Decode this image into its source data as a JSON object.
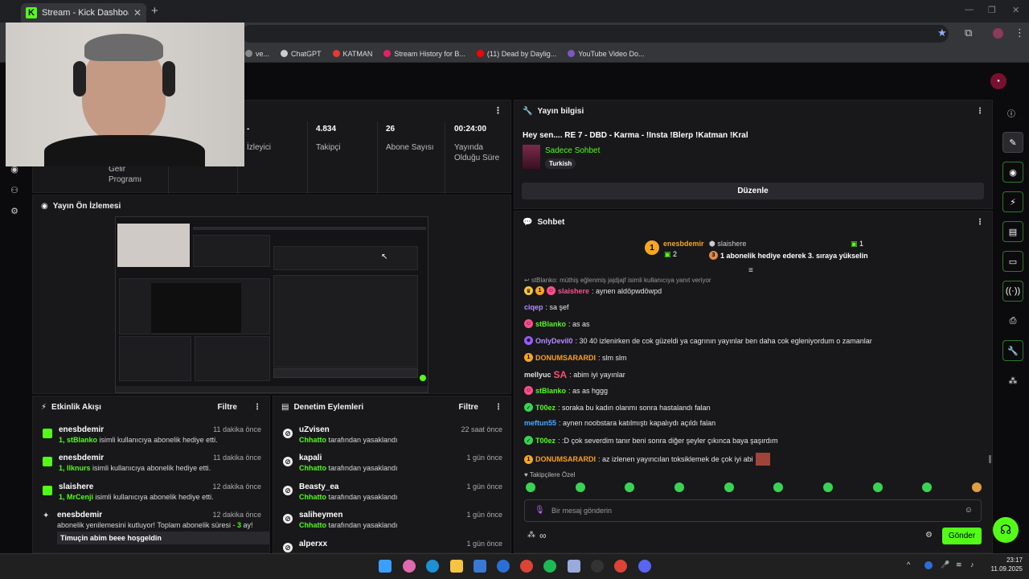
{
  "browser": {
    "tab_title": "Stream - Kick Dashboard",
    "tab_favicon": "K",
    "bookmarks": [
      {
        "label": "ve...",
        "color": "#888888"
      },
      {
        "label": "ChatGPT",
        "color": "#cccccc"
      },
      {
        "label": "KATMAN",
        "color": "#e53935"
      },
      {
        "label": "Stream History for B...",
        "color": "#e91e63"
      },
      {
        "label": "(11) Dead by Daylig...",
        "color": "#ff0000"
      },
      {
        "label": "YouTube Video Do...",
        "color": "#7e57c2"
      }
    ]
  },
  "stats": {
    "items": [
      {
        "num": "-",
        "label": "İzleyici"
      },
      {
        "num": "4.834",
        "label": "Takipçi"
      },
      {
        "num": "26",
        "label": "Abone Sayısı"
      },
      {
        "num": "00:24:00",
        "label": "Yayında Olduğu Süre"
      }
    ],
    "partial_label": "Gelir Programı"
  },
  "preview": {
    "title": "Yayın Ön İzlemesi"
  },
  "activity": {
    "title": "Etkinlik Akışı",
    "filter": "Filtre",
    "items": [
      {
        "name": "enesbdemir",
        "time": "11 dakika önce",
        "count": "1,",
        "target": "stBlanko",
        "text": " isimli kullanıcıya abonelik hediye etti."
      },
      {
        "name": "enesbdemir",
        "time": "11 dakika önce",
        "count": "1,",
        "target": "llknurs",
        "text": " isimli kullanıcıya abonelik hediye etti."
      },
      {
        "name": "slaishere",
        "time": "12 dakika önce",
        "count": "1,",
        "target": "MrCenji",
        "text": " isimli kullanıcıya abonelik hediye etti."
      }
    ],
    "renew": {
      "name": "enesbdemir",
      "time": "12 dakika önce",
      "text_pre": "abonelik yenilemesini kutluyor! Toplam abonelik süresi - ",
      "months": "3",
      "text_post": " ay!",
      "message": "Timuçin abim beee hoşgeldin"
    }
  },
  "moderation": {
    "title": "Denetim Eylemleri",
    "filter": "Filtre",
    "items": [
      {
        "name": "uZvisen",
        "time": "22 saat önce",
        "by": "Chhatto",
        "text": " tarafından yasaklandı"
      },
      {
        "name": "kapali",
        "time": "1 gün önce",
        "by": "Chhatto",
        "text": " tarafından yasaklandı"
      },
      {
        "name": "Beasty_ea",
        "time": "1 gün önce",
        "by": "Chhatto",
        "text": " tarafından yasaklandı"
      },
      {
        "name": "saliheymen",
        "time": "1 gün önce",
        "by": "Chhatto",
        "text": " tarafından yasaklandı"
      },
      {
        "name": "alperxx",
        "time": "1 gün önce",
        "by": "",
        "text": ""
      }
    ]
  },
  "info": {
    "title": "Yayın bilgisi",
    "stream_title": "Hey sen.... RE 7 - DBD - Karma - !Insta !Blerp !Katman !Kral",
    "category": "Sadece Sohbet",
    "language": "Turkish",
    "edit": "Düzenle"
  },
  "chat": {
    "title": "Sohbet",
    "pinned": {
      "rank": "1",
      "gifter": "enesbdemir",
      "gifter_count": "2",
      "user": "slaishere",
      "user_count": "1",
      "rank2": "3",
      "text": "1 abonelik hediye ederek 3. sıraya yükselin"
    },
    "reply_context": "stBlanko: müthiş eğlenmiş jajdjajf isimli kullanıcıya yanıt veriyor",
    "messages": [
      {
        "user": "slaishere",
        "color": "#ff4f8b",
        "text": ": aynen aldöpwdöwpd",
        "badges": [
          "crown",
          "1",
          "mask"
        ]
      },
      {
        "user": "ciqep",
        "color": "#b58cff",
        "text": ": sa şef",
        "badges": []
      },
      {
        "user": "stBlanko",
        "color": "#53fc18",
        "text": ": as as",
        "badges": [
          "mask"
        ]
      },
      {
        "user": "OnlyDevil0",
        "color": "#b58cff",
        "text": ": 30 40 izlenirken de cok güzeldi ya cagrının yayınlar ben daha cok egleniyordum o zamanlar",
        "badges": [
          "devil"
        ]
      },
      {
        "user": "DONUMSARARDI",
        "color": "#ff9f1c",
        "text": ": slm slm",
        "badges": [
          "1"
        ]
      },
      {
        "user": "mellyuc",
        "color": "#e0e0e0",
        "text": ": abim iyi yayınlar",
        "badges": [
          "sa"
        ]
      },
      {
        "user": "stBlanko",
        "color": "#53fc18",
        "text": ": as as hggg",
        "badges": [
          "mask"
        ]
      },
      {
        "user": "T00ez",
        "color": "#53fc18",
        "text": ": soraka bu kadın olanmı sonra hastalandı falan",
        "badges": [
          "check"
        ]
      },
      {
        "user": "meftun55",
        "color": "#4aa8ff",
        "text": ": aynen noobstara katılmıştı kapalıydı açıldı falan",
        "badges": []
      },
      {
        "user": "T00ez",
        "color": "#53fc18",
        "text": ": :D çok severdim tanır beni sonra diğer şeyler çıkınca baya şaşırdım",
        "badges": [
          "check"
        ]
      },
      {
        "user": "DONUMSARARDI",
        "color": "#ff9f1c",
        "text": ": az izlenen yayıncılan toksiklemek de çok iyi abi",
        "badges": [
          "1"
        ]
      }
    ],
    "followers_only": "Takipçilere Özel",
    "input_placeholder": "Bir mesaj gönderin",
    "send": "Gönder",
    "infinity": "∞"
  },
  "taskbar": {
    "time": "23:17",
    "date": "11.09.2025"
  },
  "colors": {
    "accent": "#53fc18",
    "panel": "#18181b",
    "bg": "#0b0b0d"
  }
}
